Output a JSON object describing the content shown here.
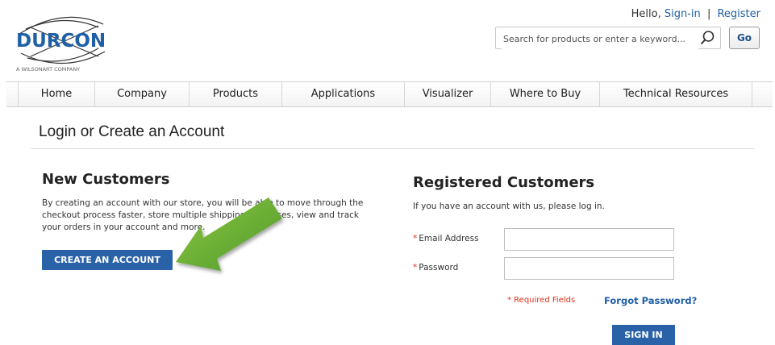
{
  "header": {
    "logo_text": "DURCON",
    "logo_tagline": "A WILSONART COMPANY",
    "hello": "Hello,",
    "sign_in": "Sign-in",
    "separator": "|",
    "register": "Register",
    "search_placeholder": "Search for products or enter a keyword...",
    "go_label": "Go"
  },
  "nav": {
    "items": [
      {
        "label": "Home"
      },
      {
        "label": "Company"
      },
      {
        "label": "Products"
      },
      {
        "label": "Applications"
      },
      {
        "label": "Visualizer"
      },
      {
        "label": "Where to Buy"
      },
      {
        "label": "Technical Resources"
      }
    ]
  },
  "page": {
    "title": "Login or Create an Account"
  },
  "new_customers": {
    "heading": "New Customers",
    "body": "By creating an account with our store, you will be able to move through the checkout process faster, store multiple shipping addresses, view and track your orders in your account and more.",
    "button_label": "CREATE AN ACCOUNT"
  },
  "registered": {
    "heading": "Registered Customers",
    "intro": "If you have an account with us, please log in.",
    "email_label": "Email Address",
    "password_label": "Password",
    "required_star": "*",
    "required_note": "* Required Fields",
    "forgot_label": "Forgot Password?",
    "signin_label": "SIGN IN"
  },
  "colors": {
    "accent_blue": "#2a62a8",
    "link_blue": "#1f5fa6",
    "required_red": "#e0311c",
    "arrow_green": "#6cb33f"
  },
  "icons": {
    "search": "search-icon",
    "arrow": "green-arrow-icon"
  }
}
